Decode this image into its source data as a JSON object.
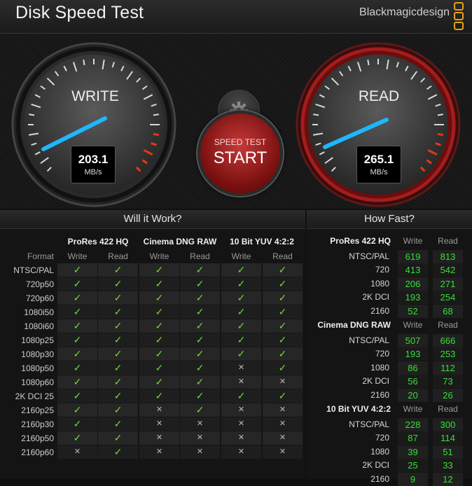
{
  "app": {
    "title": "Disk Speed Test",
    "brand": "Blackmagicdesign"
  },
  "gauges": {
    "write": {
      "label": "WRITE",
      "value": "203.1",
      "unit": "MB/s"
    },
    "read": {
      "label": "READ",
      "value": "265.1",
      "unit": "MB/s"
    }
  },
  "start_button": {
    "line1": "SPEED TEST",
    "line2": "START"
  },
  "sections": {
    "left_title": "Will it Work?",
    "right_title": "How Fast?"
  },
  "will_it_work": {
    "format_header": "Format",
    "groups": [
      "ProRes 422 HQ",
      "Cinema DNG RAW",
      "10 Bit YUV 4:2:2"
    ],
    "col_write": "Write",
    "col_read": "Read",
    "rows": [
      {
        "format": "NTSC/PAL",
        "cells": [
          1,
          1,
          1,
          1,
          1,
          1
        ]
      },
      {
        "format": "720p50",
        "cells": [
          1,
          1,
          1,
          1,
          1,
          1
        ]
      },
      {
        "format": "720p60",
        "cells": [
          1,
          1,
          1,
          1,
          1,
          1
        ]
      },
      {
        "format": "1080i50",
        "cells": [
          1,
          1,
          1,
          1,
          1,
          1
        ]
      },
      {
        "format": "1080i60",
        "cells": [
          1,
          1,
          1,
          1,
          1,
          1
        ]
      },
      {
        "format": "1080p25",
        "cells": [
          1,
          1,
          1,
          1,
          1,
          1
        ]
      },
      {
        "format": "1080p30",
        "cells": [
          1,
          1,
          1,
          1,
          1,
          1
        ]
      },
      {
        "format": "1080p50",
        "cells": [
          1,
          1,
          1,
          1,
          0,
          1
        ]
      },
      {
        "format": "1080p60",
        "cells": [
          1,
          1,
          1,
          1,
          0,
          0
        ]
      },
      {
        "format": "2K DCI 25",
        "cells": [
          1,
          1,
          1,
          1,
          1,
          1
        ]
      },
      {
        "format": "2160p25",
        "cells": [
          1,
          1,
          0,
          1,
          0,
          0
        ]
      },
      {
        "format": "2160p30",
        "cells": [
          1,
          1,
          0,
          0,
          0,
          0
        ]
      },
      {
        "format": "2160p50",
        "cells": [
          1,
          1,
          0,
          0,
          0,
          0
        ]
      },
      {
        "format": "2160p60",
        "cells": [
          0,
          1,
          0,
          0,
          0,
          0
        ]
      }
    ]
  },
  "how_fast": {
    "col_write": "Write",
    "col_read": "Read",
    "groups": [
      {
        "name": "ProRes 422 HQ",
        "rows": [
          {
            "format": "NTSC/PAL",
            "write": "619",
            "read": "813"
          },
          {
            "format": "720",
            "write": "413",
            "read": "542"
          },
          {
            "format": "1080",
            "write": "206",
            "read": "271"
          },
          {
            "format": "2K DCI",
            "write": "193",
            "read": "254"
          },
          {
            "format": "2160",
            "write": "52",
            "read": "68"
          }
        ]
      },
      {
        "name": "Cinema DNG RAW",
        "rows": [
          {
            "format": "NTSC/PAL",
            "write": "507",
            "read": "666"
          },
          {
            "format": "720",
            "write": "193",
            "read": "253"
          },
          {
            "format": "1080",
            "write": "86",
            "read": "112"
          },
          {
            "format": "2K DCI",
            "write": "56",
            "read": "73"
          },
          {
            "format": "2160",
            "write": "20",
            "read": "26"
          }
        ]
      },
      {
        "name": "10 Bit YUV 4:2:2",
        "rows": [
          {
            "format": "NTSC/PAL",
            "write": "228",
            "read": "300"
          },
          {
            "format": "720",
            "write": "87",
            "read": "114"
          },
          {
            "format": "1080",
            "write": "39",
            "read": "51"
          },
          {
            "format": "2K DCI",
            "write": "25",
            "read": "33"
          },
          {
            "format": "2160",
            "write": "9",
            "read": "12"
          }
        ]
      }
    ]
  },
  "symbols": {
    "ok": "✓",
    "no": "✕"
  },
  "colors": {
    "ok_green": "#6fd83a",
    "speed_green": "#34e034",
    "needle_blue": "#1fb6ff",
    "read_ring_red": "#8a1414",
    "start_red": "#b82828",
    "brand_orange": "#e4a11b"
  }
}
